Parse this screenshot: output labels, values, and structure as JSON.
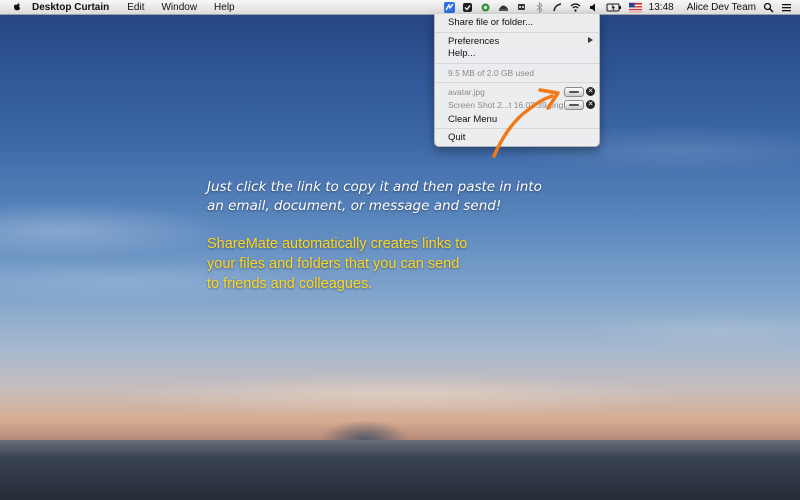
{
  "menubar": {
    "app_name": "Desktop Curtain",
    "menus": [
      "Edit",
      "Window",
      "Help"
    ],
    "clock": "13:48",
    "user": "Alice Dev Team",
    "status_icons": [
      "sharemate-icon",
      "dropbox-check-icon",
      "settings-gear-icon",
      "helmet-icon",
      "robot-icon",
      "bluetooth-icon",
      "time-machine-icon",
      "wifi-icon",
      "volume-icon",
      "battery-icon",
      "us-flag-icon",
      "spotlight-search-icon",
      "list-icon"
    ]
  },
  "dropdown": {
    "share": "Share file or folder...",
    "preferences": "Preferences",
    "help": "Help...",
    "usage": "9.5 MB of 2.0 GB used",
    "files": [
      {
        "name": "avatar.jpg"
      },
      {
        "name": "Screen Shot 2...t 16.02.39.png"
      }
    ],
    "clear": "Clear Menu",
    "quit": "Quit"
  },
  "captions": {
    "white_lines": [
      "Just click the link to copy it and then paste in into",
      "an email, document, or message and send!"
    ],
    "yellow_lines": [
      "ShareMate automatically creates links to",
      "your files and folders that you can send",
      "to friends and colleagues."
    ]
  },
  "colors": {
    "accent_orange": "#f07a1a",
    "caption_yellow": "#ffd61f",
    "active_status": "#2f6fe0"
  }
}
